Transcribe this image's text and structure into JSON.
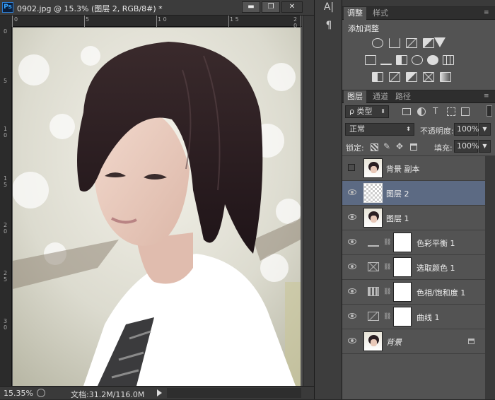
{
  "document": {
    "app_icon": "Ps",
    "title": "0902.jpg @ 15.3% (图层 2, RGB/8#) *",
    "minimize_glyph": "▬",
    "maximize_glyph": "❐",
    "close_glyph": "✕",
    "ruler_top": [
      "0",
      "5",
      "1 0",
      "1 5",
      "2 0"
    ],
    "ruler_left": [
      "0",
      "5",
      "1 0",
      "1 5",
      "2 0",
      "2 5",
      "3 0"
    ],
    "zoom": "15.35%",
    "doc_info": "文档:31.2M/116.0M"
  },
  "toolstrip": {
    "char_glyph": "A|",
    "para_glyph": "¶"
  },
  "adjustments_panel": {
    "tabs": [
      "调整",
      "样式"
    ],
    "title": "添加调整"
  },
  "layers_panel": {
    "tabs": [
      "图层",
      "通道",
      "路径"
    ],
    "filter_kind": "ρ 类型",
    "blend_mode": "正常",
    "opacity_label": "不透明度:",
    "opacity_value": "100%",
    "lock_label": "锁定:",
    "fill_label": "填充:",
    "fill_value": "100%",
    "layers": [
      {
        "name": "背景 副本",
        "visible": false,
        "type": "image"
      },
      {
        "name": "图层 2",
        "visible": true,
        "type": "transparent",
        "selected": true
      },
      {
        "name": "图层 1",
        "visible": true,
        "type": "image"
      },
      {
        "name": "色彩平衡 1",
        "visible": true,
        "type": "adjustment",
        "icon": "balance-icon"
      },
      {
        "name": "选取颜色 1",
        "visible": true,
        "type": "adjustment",
        "icon": "selective-color-icon"
      },
      {
        "name": "色相/饱和度 1",
        "visible": true,
        "type": "adjustment",
        "icon": "hue-saturation-icon"
      },
      {
        "name": "曲线 1",
        "visible": true,
        "type": "adjustment",
        "icon": "curves-icon"
      },
      {
        "name": "背景",
        "visible": true,
        "type": "image",
        "locked": true
      }
    ]
  }
}
